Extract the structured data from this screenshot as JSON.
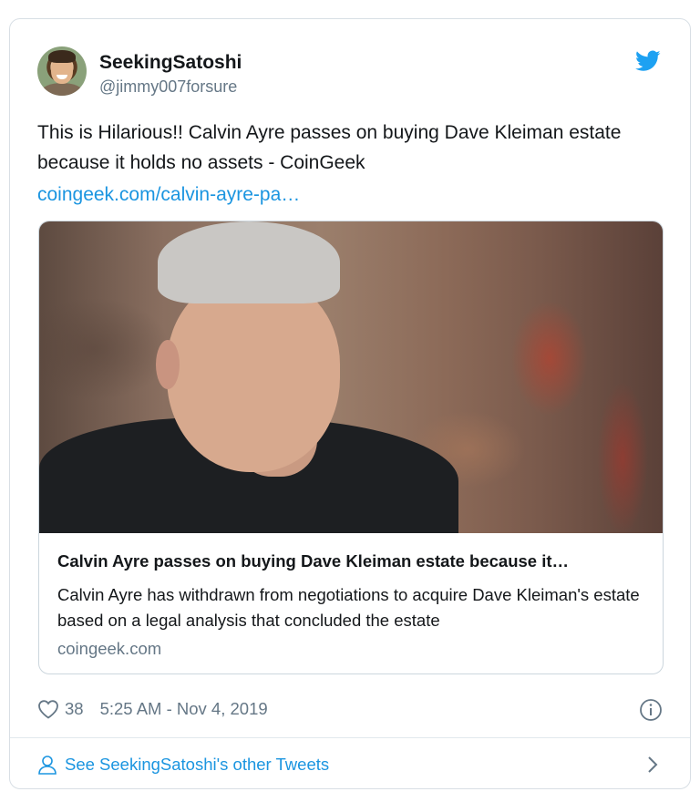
{
  "user": {
    "name": "SeekingSatoshi",
    "handle": "@jimmy007forsure"
  },
  "tweet": {
    "text": "This is Hilarious!! Calvin Ayre passes on buying Dave Kleiman estate because it holds no assets - CoinGeek",
    "link": "coingeek.com/calvin-ayre-pa…"
  },
  "card": {
    "title": "Calvin Ayre passes on buying Dave Kleiman estate because it…",
    "description": "Calvin Ayre has withdrawn from negotiations to acquire Dave Kleiman's estate based on a legal analysis that concluded the estate",
    "domain": "coingeek.com"
  },
  "meta": {
    "likes": "38",
    "timestamp": "5:25 AM - Nov 4, 2019"
  },
  "footer": {
    "label": "See SeekingSatoshi's other Tweets"
  },
  "icons": {
    "brand": "twitter-bird-icon",
    "like": "heart-icon",
    "info": "info-icon",
    "profile": "person-icon",
    "next": "chevron-right-icon"
  },
  "colors": {
    "brand": "#1da1f2",
    "link": "#1b95e0",
    "secondary_text": "#657786",
    "primary_text": "#14171a",
    "border": "#d8dfe5"
  }
}
